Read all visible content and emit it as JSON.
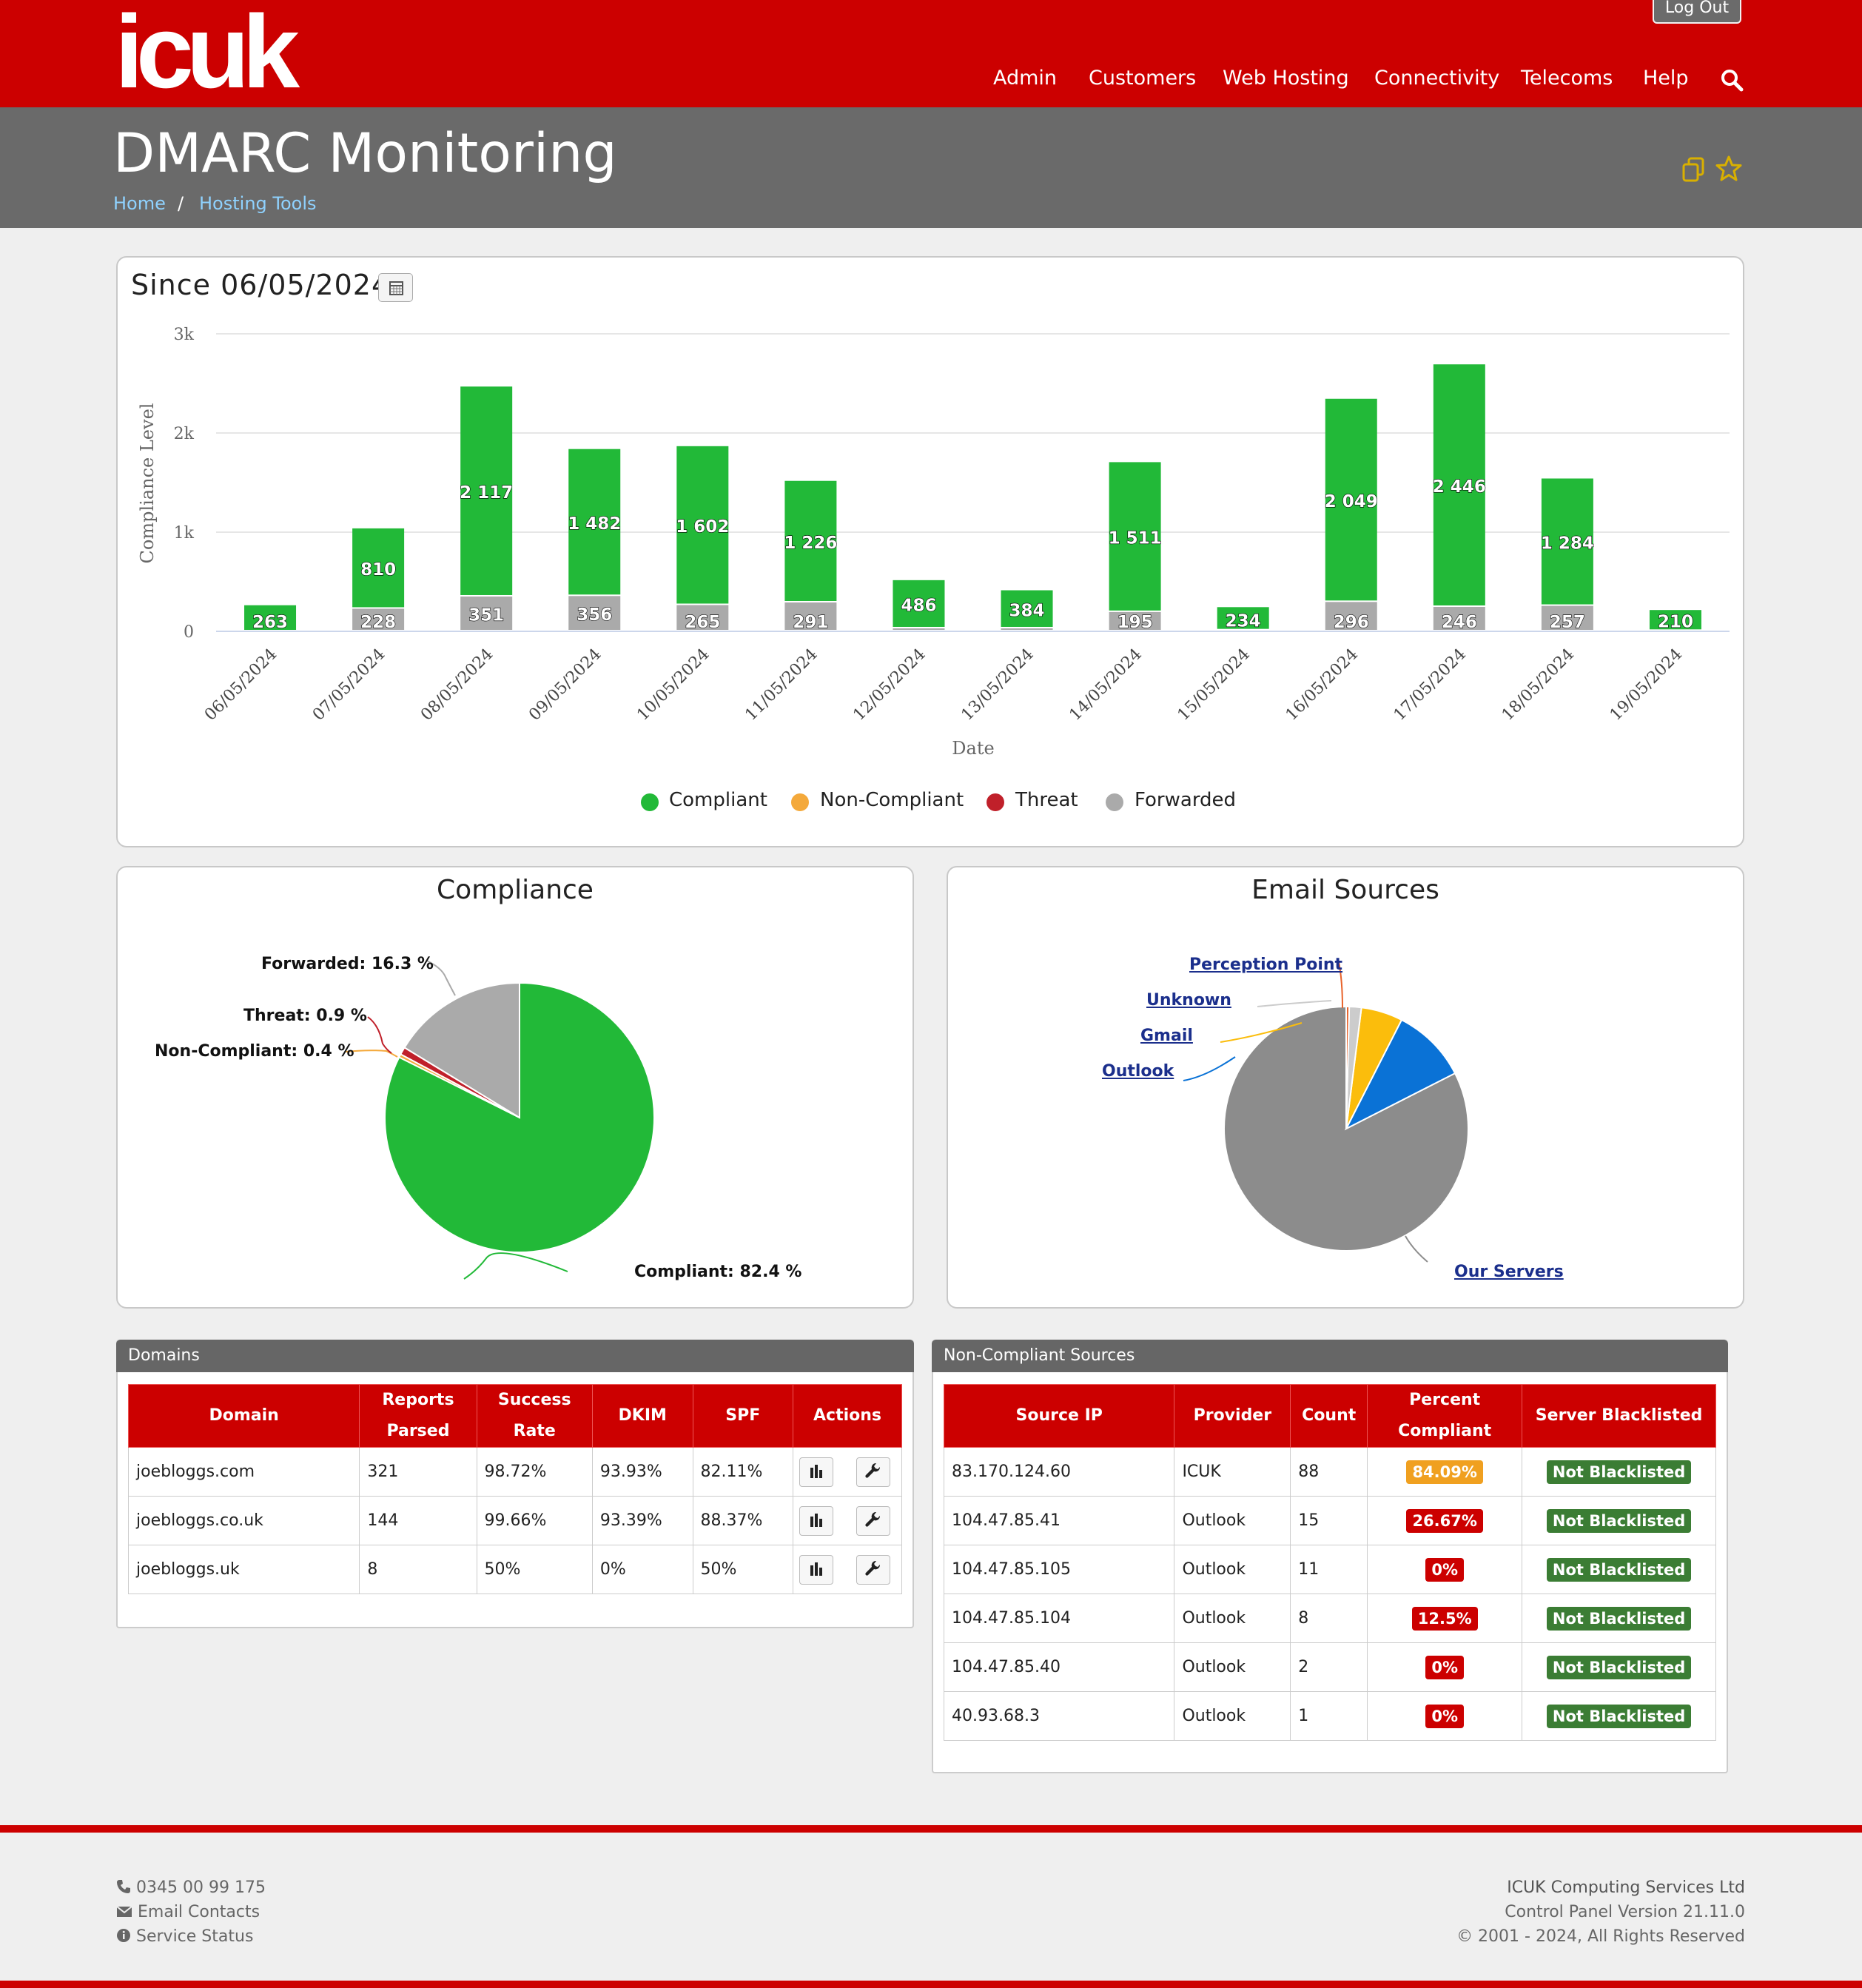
{
  "header": {
    "logo_text": "icuk",
    "logout_label": "Log Out",
    "nav": [
      "Admin",
      "Customers",
      "Web Hosting",
      "Connectivity",
      "Telecoms",
      "Help"
    ]
  },
  "title_bar": {
    "title": "DMARC Monitoring",
    "breadcrumb": [
      "Home",
      "Hosting Tools"
    ],
    "breadcrumb_sep": "/"
  },
  "colors": {
    "brand_red": "#cc0000",
    "compliant": "#22b938",
    "non_compliant": "#f4a93b",
    "threat": "#c0202a",
    "forwarded": "#aaaaaa"
  },
  "summary_chart": {
    "since_label": "Since 06/05/2024",
    "chart_data": {
      "type": "bar",
      "stacked": true,
      "title": "",
      "xlabel": "Date",
      "ylabel": "Compliance Level",
      "ylim": [
        0,
        3000
      ],
      "yticks": [
        "0",
        "1k",
        "2k",
        "3k"
      ],
      "categories": [
        "06/05/2024",
        "07/05/2024",
        "08/05/2024",
        "09/05/2024",
        "10/05/2024",
        "11/05/2024",
        "12/05/2024",
        "13/05/2024",
        "14/05/2024",
        "15/05/2024",
        "16/05/2024",
        "17/05/2024",
        "18/05/2024",
        "19/05/2024"
      ],
      "series": [
        {
          "name": "Compliant",
          "values": [
            263,
            810,
            2117,
            1482,
            1602,
            1226,
            486,
            384,
            1511,
            234,
            2049,
            2446,
            1284,
            210
          ],
          "labels": [
            "263",
            "810",
            "2 117",
            "1 482",
            "1 602",
            "1 226",
            "486",
            "384",
            "1 511",
            "234",
            "2 049",
            "2 446",
            "1 284",
            "210"
          ]
        },
        {
          "name": "Non-Compliant",
          "values": [
            0,
            0,
            0,
            0,
            0,
            0,
            0,
            0,
            0,
            0,
            0,
            0,
            0,
            0
          ]
        },
        {
          "name": "Threat",
          "values": [
            0,
            0,
            0,
            0,
            0,
            0,
            0,
            0,
            0,
            0,
            0,
            0,
            0,
            0
          ]
        },
        {
          "name": "Forwarded",
          "values": [
            0,
            228,
            351,
            356,
            265,
            291,
            30,
            30,
            195,
            10,
            296,
            246,
            257,
            5
          ],
          "labels": [
            "",
            "228",
            "351",
            "356",
            "265",
            "291",
            "",
            "",
            "195",
            "",
            "296",
            "246",
            "257",
            ""
          ]
        }
      ],
      "legend": [
        "Compliant",
        "Non-Compliant",
        "Threat",
        "Forwarded"
      ],
      "legend_position": "bottom",
      "grid": true
    }
  },
  "compliance_pie": {
    "title": "Compliance",
    "chart_data": {
      "type": "pie",
      "slices": [
        {
          "name": "Compliant",
          "value": 82.4,
          "label": "Compliant: 82.4 %"
        },
        {
          "name": "Non-Compliant",
          "value": 0.4,
          "label": "Non-Compliant: 0.4 %"
        },
        {
          "name": "Threat",
          "value": 0.9,
          "label": "Threat: 0.9 %"
        },
        {
          "name": "Forwarded",
          "value": 16.3,
          "label": "Forwarded: 16.3 %"
        }
      ]
    }
  },
  "sources_pie": {
    "title": "Email Sources",
    "chart_data": {
      "type": "pie",
      "slices": [
        {
          "name": "Our Servers",
          "value": 82.5,
          "color": "#8c8c8c"
        },
        {
          "name": "Outlook",
          "value": 10.0,
          "color": "#0a72d6"
        },
        {
          "name": "Gmail",
          "value": 5.5,
          "color": "#fbbd0c"
        },
        {
          "name": "Unknown",
          "value": 1.6,
          "color": "#cccccc"
        },
        {
          "name": "Perception Point",
          "value": 0.4,
          "color": "#e8632b"
        }
      ]
    }
  },
  "domains": {
    "panel_title": "Domains",
    "columns": [
      "Domain",
      "Reports Parsed",
      "Success Rate",
      "DKIM",
      "SPF",
      "Actions"
    ],
    "rows": [
      {
        "domain": "joebloggs.com",
        "reports": "321",
        "success": "98.72%",
        "dkim": "93.93%",
        "spf": "82.11%"
      },
      {
        "domain": "joebloggs.co.uk",
        "reports": "144",
        "success": "99.66%",
        "dkim": "93.39%",
        "spf": "88.37%"
      },
      {
        "domain": "joebloggs.uk",
        "reports": "8",
        "success": "50%",
        "dkim": "0%",
        "spf": "50%"
      }
    ]
  },
  "noncompliant": {
    "panel_title": "Non-Compliant Sources",
    "columns": [
      "Source IP",
      "Provider",
      "Count",
      "Percent Compliant",
      "Server Blacklisted"
    ],
    "rows": [
      {
        "ip": "83.170.124.60",
        "provider": "ICUK",
        "count": "88",
        "percent": "84.09%",
        "percent_color": "#f0a020",
        "blacklist": "Not Blacklisted"
      },
      {
        "ip": "104.47.85.41",
        "provider": "Outlook",
        "count": "15",
        "percent": "26.67%",
        "percent_color": "#cc0000",
        "blacklist": "Not Blacklisted"
      },
      {
        "ip": "104.47.85.105",
        "provider": "Outlook",
        "count": "11",
        "percent": "0%",
        "percent_color": "#cc0000",
        "blacklist": "Not Blacklisted"
      },
      {
        "ip": "104.47.85.104",
        "provider": "Outlook",
        "count": "8",
        "percent": "12.5%",
        "percent_color": "#cc0000",
        "blacklist": "Not Blacklisted"
      },
      {
        "ip": "104.47.85.40",
        "provider": "Outlook",
        "count": "2",
        "percent": "0%",
        "percent_color": "#cc0000",
        "blacklist": "Not Blacklisted"
      },
      {
        "ip": "40.93.68.3",
        "provider": "Outlook",
        "count": "1",
        "percent": "0%",
        "percent_color": "#cc0000",
        "blacklist": "Not Blacklisted"
      }
    ]
  },
  "footer": {
    "phone": "0345 00 99 175",
    "email_contacts": "Email Contacts",
    "service_status": "Service Status",
    "company": "ICUK Computing Services Ltd",
    "version": "Control Panel Version 21.11.0",
    "copyright": "© 2001 - 2024, All Rights Reserved"
  }
}
